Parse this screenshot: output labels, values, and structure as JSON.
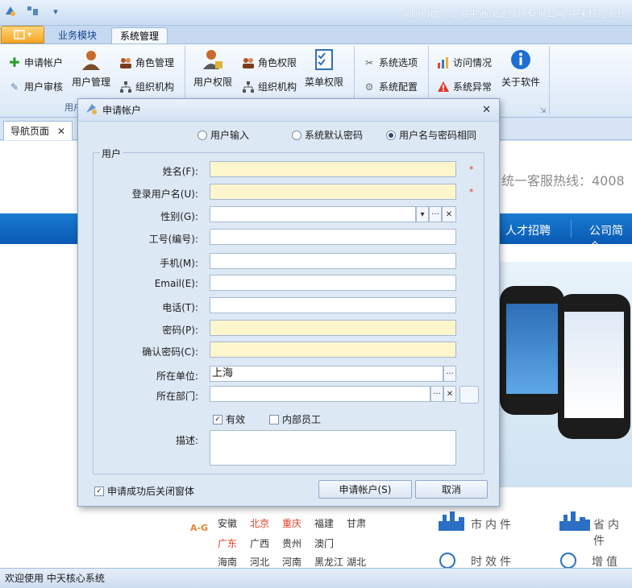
{
  "window": {
    "title": "导航页面 - 上海中通快递股份有限公司-中天核心系统"
  },
  "ribbon": {
    "tabs": [
      "业务模块",
      "系统管理"
    ],
    "groups": {
      "g1": {
        "items": [
          "申请帐户",
          "用户审核",
          "用户管理",
          "角色管理",
          "组织机构"
        ],
        "label": "用户"
      },
      "g2": {
        "items": [
          "用户权限",
          "角色权限",
          "组织机构",
          "菜单权限"
        ]
      },
      "g3": {
        "items": [
          "系统选项",
          "系统配置"
        ]
      },
      "g4": {
        "items": [
          "访问情况",
          "系统异常",
          "关于软件"
        ]
      }
    }
  },
  "doc_tab": {
    "label": "导航页面"
  },
  "webpage": {
    "hotline": "统一客服热线：4008",
    "nav": [
      "人才招聘",
      "公司简介"
    ],
    "region_tag": "A-G",
    "cities_row1": [
      "安徽",
      "北京",
      "重庆",
      "福建",
      "甘肃"
    ],
    "cities_row2": [
      "广东",
      "广西",
      "贵州",
      "澳门"
    ],
    "cities_row3": [
      "海南",
      "河北",
      "河南",
      "黑龙江",
      "湖北"
    ],
    "svc1": "市内件",
    "svc2": "省内件",
    "svc3": "时效件",
    "svc4": "增值服务"
  },
  "status": {
    "text": "欢迎使用 中天核心系统"
  },
  "dialog": {
    "title": "申请帐户",
    "radios": [
      {
        "label": "用户输入",
        "selected": false
      },
      {
        "label": "系统默认密码",
        "selected": false
      },
      {
        "label": "用户名与密码相同",
        "selected": true
      }
    ],
    "legend": "用户",
    "fields": {
      "name": {
        "label": "姓名(F):",
        "value": ""
      },
      "username": {
        "label": "登录用户名(U):",
        "value": ""
      },
      "gender": {
        "label": "性别(G):",
        "value": ""
      },
      "empno": {
        "label": "工号(编号):",
        "value": ""
      },
      "mobile": {
        "label": "手机(M):",
        "value": ""
      },
      "email": {
        "label": "Email(E):",
        "value": ""
      },
      "phone": {
        "label": "电话(T):",
        "value": ""
      },
      "password": {
        "label": "密码(P):",
        "value": ""
      },
      "confirm": {
        "label": "确认密码(C):",
        "value": ""
      },
      "unit": {
        "label": "所在单位:",
        "value": "上海"
      },
      "dept": {
        "label": "所在部门:",
        "value": ""
      },
      "desc": {
        "label": "描述:",
        "value": ""
      }
    },
    "checks": {
      "active": {
        "label": "有效",
        "checked": true
      },
      "internal": {
        "label": "内部员工",
        "checked": false
      },
      "close_after": {
        "label": "申请成功后关闭窗体",
        "checked": true
      }
    },
    "buttons": {
      "submit": "申请帐户(S)",
      "cancel": "取消"
    }
  }
}
